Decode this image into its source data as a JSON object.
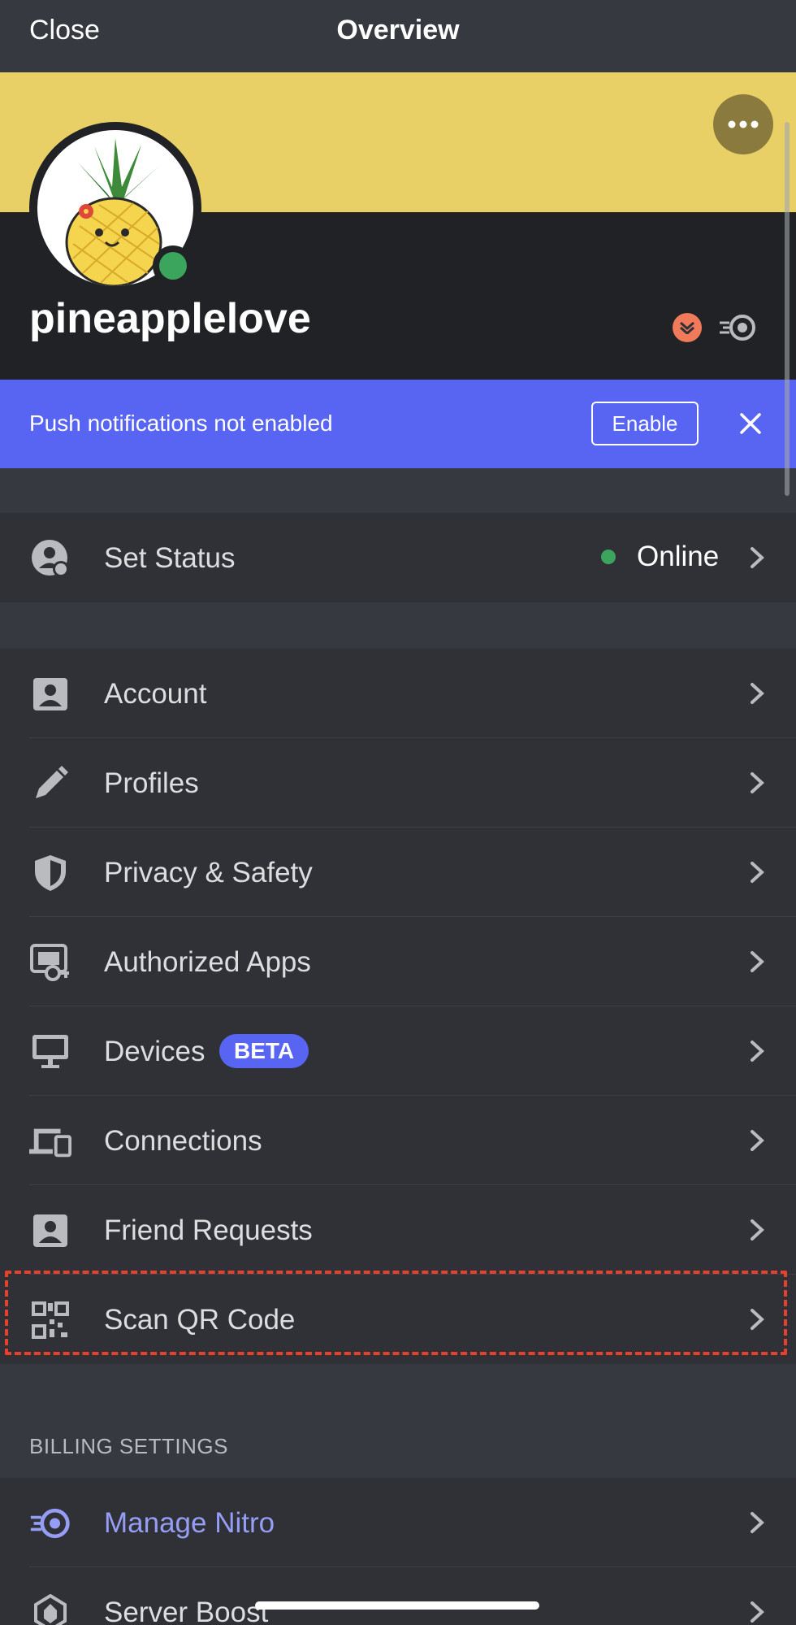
{
  "topbar": {
    "close_label": "Close",
    "title": "Overview"
  },
  "profile": {
    "username": "pineapplelove",
    "banner_color": "#e9d066",
    "presence_color": "#3ba55d",
    "badges": [
      "hypesquad-icon",
      "nitro-icon"
    ]
  },
  "push_banner": {
    "text": "Push notifications not enabled",
    "enable_label": "Enable",
    "background": "#5865f2"
  },
  "status_row": {
    "label": "Set Status",
    "value": "Online"
  },
  "settings": {
    "items": [
      {
        "label": "Account",
        "icon": "account-icon"
      },
      {
        "label": "Profiles",
        "icon": "pencil-icon"
      },
      {
        "label": "Privacy & Safety",
        "icon": "shield-icon"
      },
      {
        "label": "Authorized Apps",
        "icon": "authorized-apps-icon"
      },
      {
        "label": "Devices",
        "icon": "monitor-icon",
        "badge": "BETA"
      },
      {
        "label": "Connections",
        "icon": "devices-icon"
      },
      {
        "label": "Friend Requests",
        "icon": "friend-requests-icon"
      },
      {
        "label": "Scan QR Code",
        "icon": "qr-code-icon"
      }
    ]
  },
  "billing": {
    "header": "BILLING SETTINGS",
    "items": [
      {
        "label": "Manage Nitro",
        "icon": "nitro-icon"
      },
      {
        "label": "Server Boost",
        "icon": "server-boost-icon"
      }
    ]
  }
}
